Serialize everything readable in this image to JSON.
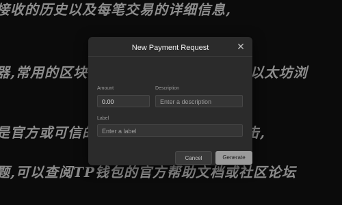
{
  "background": {
    "lines": [
      "接收的历史以及每笔交易的详细信息,",
      "器,常用的区块浏览器包括Etherscan)以太坊浏",
      "是官方或可信的网站,以防钓鱼网站的攻击,",
      "题,可以查阅TP钱包的官方帮助文档或社区论坛"
    ]
  },
  "modal": {
    "title": "New Payment Request",
    "close_icon": "close-icon",
    "fields": {
      "amount_label": "Amount",
      "amount_value": "0.00",
      "description_label": "Description",
      "description_placeholder": "Enter a description",
      "label_label": "Label",
      "label_placeholder": "Enter a label"
    },
    "buttons": {
      "cancel": "Cancel",
      "generate": "Generate"
    }
  },
  "colors": {
    "modal_bg": "#2b2b2b",
    "generate_button": "#9a9a9a"
  }
}
